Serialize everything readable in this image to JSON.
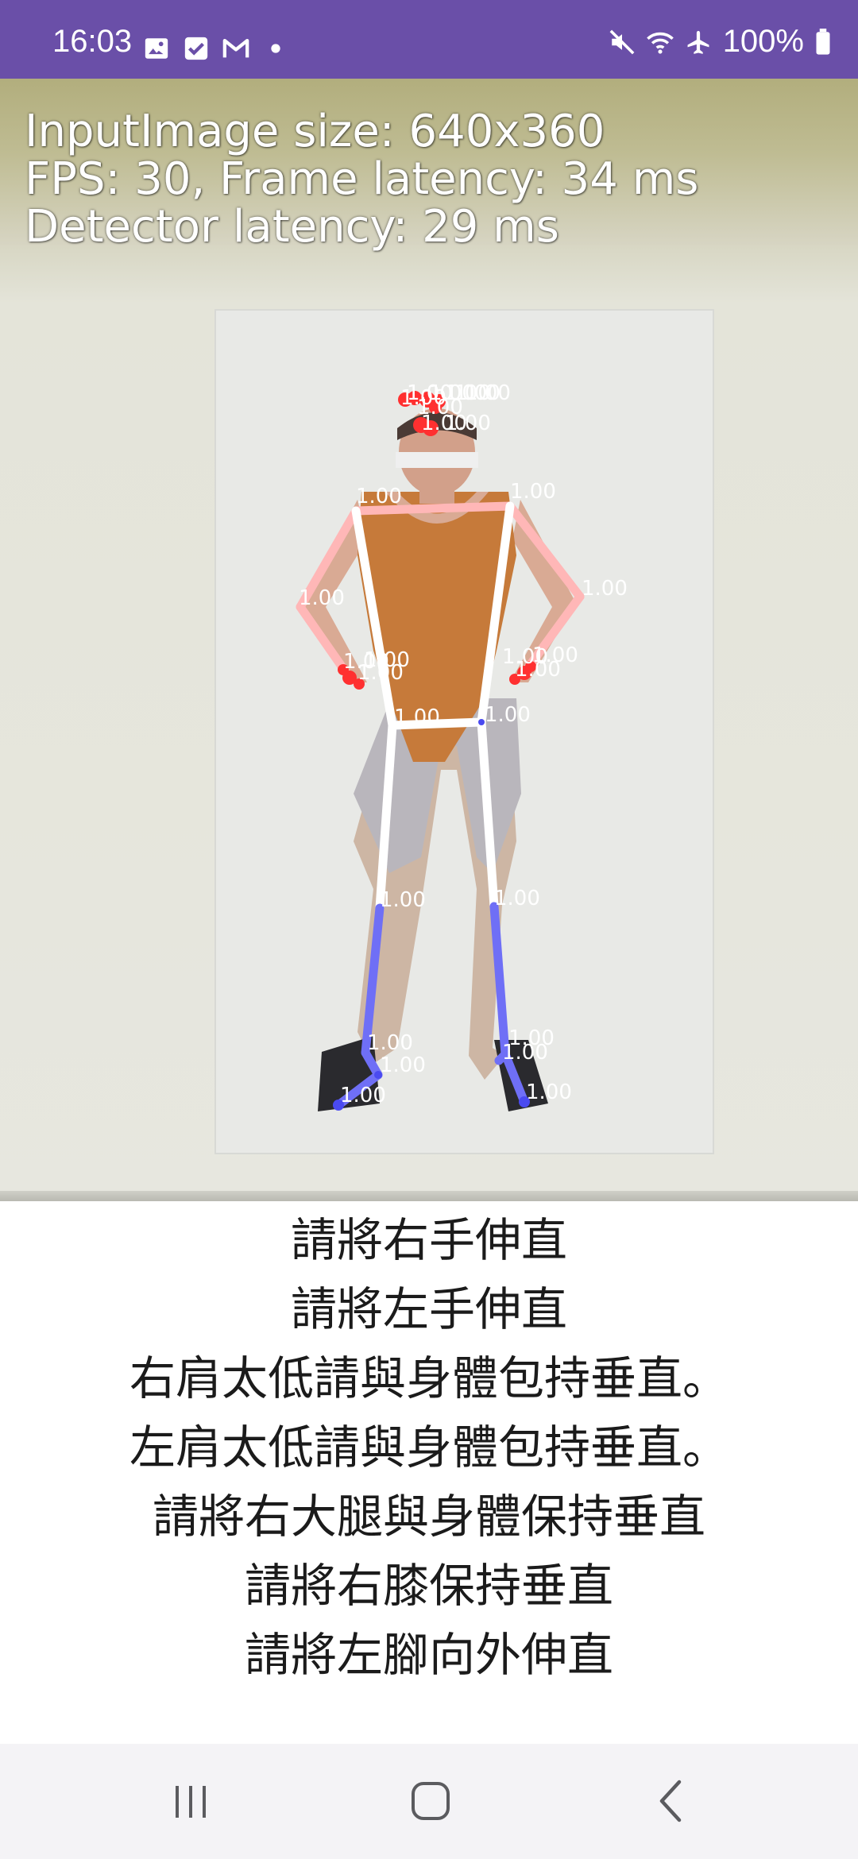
{
  "status_bar": {
    "time": "16:03",
    "left_icons": [
      "image-icon",
      "checkbox-icon",
      "gmail-icon",
      "dot-icon"
    ],
    "right_icons": [
      "mute-icon",
      "wifi-icon",
      "airplane-icon"
    ],
    "battery": "100%",
    "background": "#6a4fa8"
  },
  "camera": {
    "overlay": {
      "input_size": "InputImage size: 640x360",
      "fps": "FPS: 30, Frame latency: 34 ms",
      "detector": "Detector latency: 29 ms"
    },
    "keypoint_scores": {
      "nose": "1.00",
      "left_eye_inner": "1.00",
      "left_eye": "1.00",
      "left_eye_outer": "1.00",
      "right_eye_inner": "1.00",
      "right_eye": "1.00",
      "right_eye_outer": "1.00",
      "left_ear": "1.00",
      "right_ear": "1.00",
      "mouth_left": "1.00",
      "mouth_right": "1.00",
      "right_shoulder": "1.00",
      "left_shoulder": "1.00",
      "right_elbow": "1.00",
      "left_elbow": "1.00",
      "right_wrist": "1.00",
      "right_wrist_b": "1.00",
      "right_wrist_c": "1.00",
      "left_wrist": "1.00",
      "left_wrist_b": "1.00",
      "left_wrist_c": "1.00",
      "right_hip": "1.00",
      "left_hip": "1.00",
      "right_knee": "1.00",
      "left_knee": "1.00",
      "right_ankle": "1.00",
      "right_heel": "1.00",
      "right_foot": "1.00",
      "left_ankle": "1.00",
      "left_heel": "1.00",
      "left_foot": "1.00"
    },
    "colors": {
      "arms": "#ffb7b7",
      "torso": "#ffffff",
      "legs": "#6f6ff6",
      "joints_face": "#ff3030"
    }
  },
  "feedback": {
    "lines": [
      "請將右手伸直",
      "請將左手伸直",
      "右肩太低請與身體包持垂直。",
      "左肩太低請與身體包持垂直。",
      "請將右大腿與身體保持垂直",
      "請將右膝保持垂直",
      "請將左腳向外伸直"
    ]
  },
  "nav_bar": {
    "buttons": [
      "recent-apps-icon",
      "home-icon",
      "back-icon"
    ]
  }
}
